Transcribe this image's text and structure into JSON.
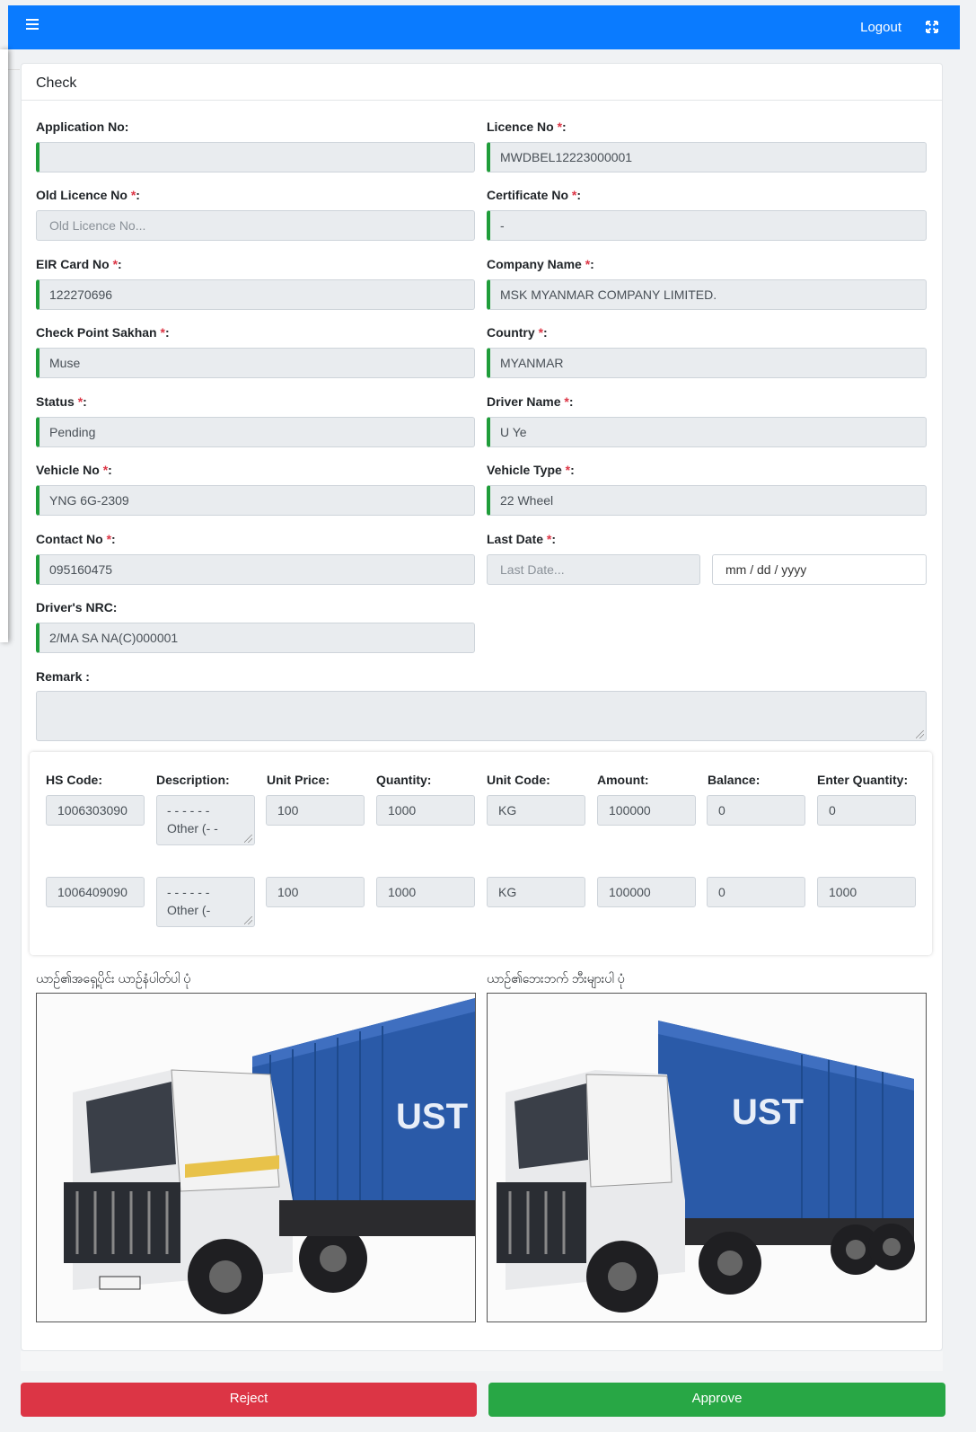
{
  "header": {
    "logout_label": "Logout"
  },
  "card": {
    "title": "Check"
  },
  "form": {
    "application_no": {
      "label": "Application No:",
      "value": ""
    },
    "licence_no": {
      "label": "Licence No",
      "value": "MWDBEL12223000001"
    },
    "old_licence_no": {
      "label": "Old Licence No",
      "placeholder": "Old Licence No..."
    },
    "certificate_no": {
      "label": "Certificate No",
      "value": "-"
    },
    "eir_card_no": {
      "label": "EIR Card No",
      "value": "122270696"
    },
    "company_name": {
      "label": "Company Name",
      "value": "MSK MYANMAR COMPANY LIMITED."
    },
    "check_point": {
      "label": "Check Point Sakhan",
      "value": "Muse"
    },
    "country": {
      "label": "Country",
      "value": "MYANMAR"
    },
    "status": {
      "label": "Status",
      "value": "Pending"
    },
    "driver_name": {
      "label": "Driver Name",
      "value": "U Ye"
    },
    "vehicle_no": {
      "label": "Vehicle No",
      "value": "YNG 6G-2309"
    },
    "vehicle_type": {
      "label": "Vehicle Type",
      "value": "22 Wheel"
    },
    "contact_no": {
      "label": "Contact No",
      "value": "095160475"
    },
    "last_date": {
      "label": "Last Date",
      "placeholder": "Last Date...",
      "date_placeholder": "mm / dd / yyyy"
    },
    "driver_nrc": {
      "label": "Driver's NRC:",
      "value": "2/MA SA NA(C)000001"
    },
    "remark": {
      "label": "Remark :",
      "value": ""
    },
    "required_mark": "*",
    "colon": ":"
  },
  "items": {
    "headers": [
      "HS Code:",
      "Description:",
      "Unit Price:",
      "Quantity:",
      "Unit Code:",
      "Amount:",
      "Balance:",
      "Enter Quantity:"
    ],
    "rows": [
      {
        "hs_code": "1006303090",
        "desc_line1": "- - - - - -",
        "desc_line2": "Other (- -",
        "unit_price": "100",
        "quantity": "1000",
        "unit_code": "KG",
        "amount": "100000",
        "balance": "0",
        "enter_quantity": "0"
      },
      {
        "hs_code": "1006409090",
        "desc_line1": "- - - - - -",
        "desc_line2": "Other (-",
        "unit_price": "100",
        "quantity": "1000",
        "unit_code": "KG",
        "amount": "100000",
        "balance": "0",
        "enter_quantity": "1000"
      }
    ]
  },
  "photos": {
    "front_label": "ယာဉ်၏အရှေ့ပိုင်း ယာဉ်နံပါတ်ပါ ပုံ",
    "back_label": "ယာဉ်၏ဘေးဘက် ဘီးများပါ ပုံ",
    "truck_text": "UST"
  },
  "actions": {
    "reject_label": "Reject",
    "approve_label": "Approve"
  },
  "colors": {
    "primary": "#0a7bff",
    "valid": "#1f9d3a",
    "reject": "#dc3545",
    "approve": "#28a745",
    "required": "#dc3545"
  }
}
